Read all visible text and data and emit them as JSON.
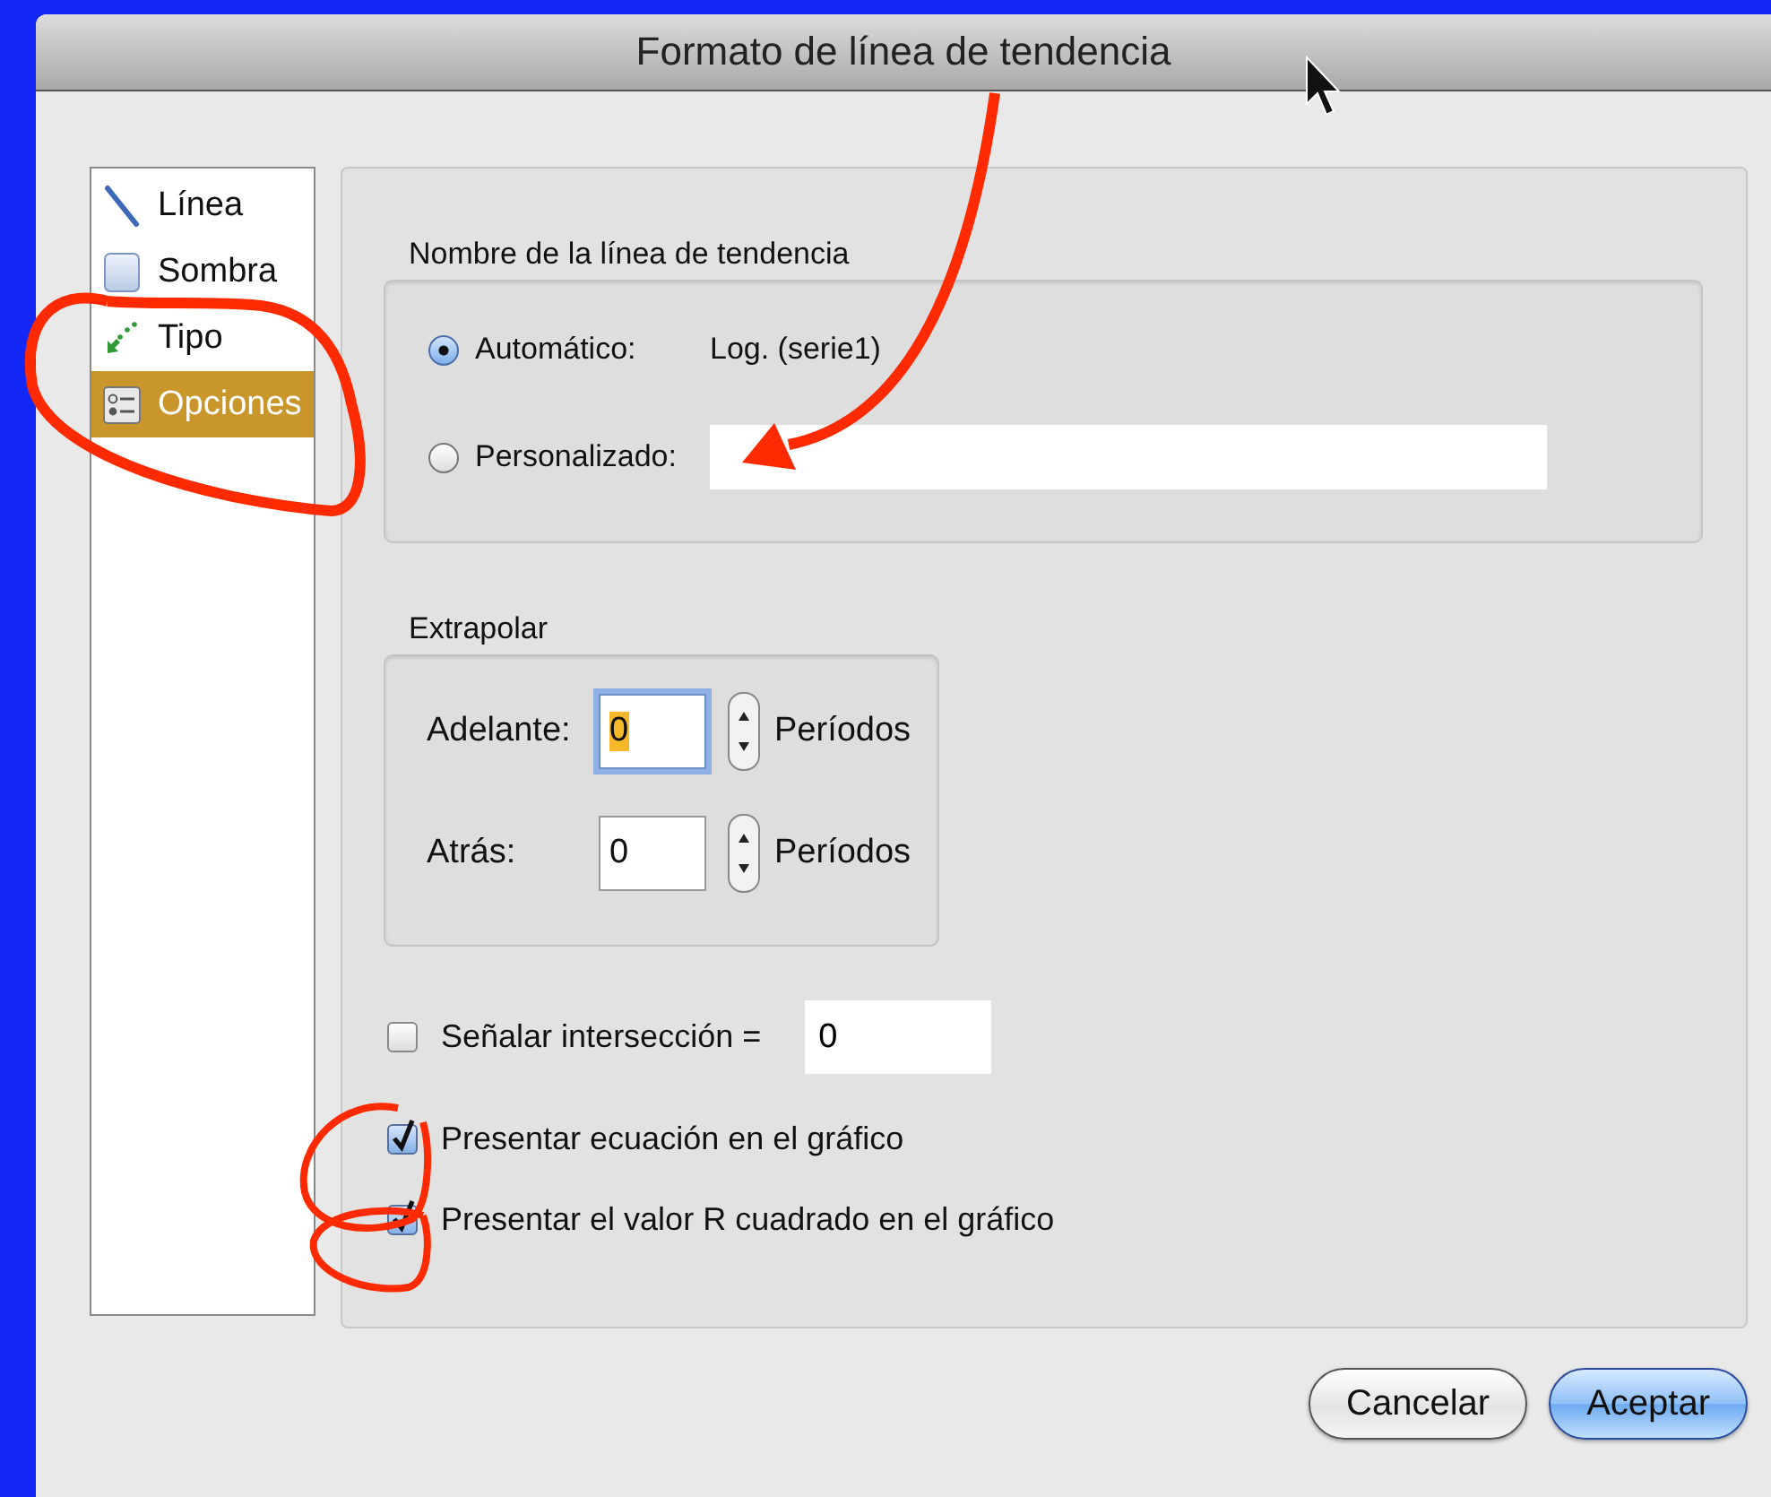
{
  "window": {
    "title": "Formato de línea de tendencia"
  },
  "sidebar": {
    "items": [
      {
        "label": "Línea",
        "kind": "line",
        "selected": false
      },
      {
        "label": "Sombra",
        "kind": "shadow",
        "selected": false
      },
      {
        "label": "Tipo",
        "kind": "type",
        "selected": false
      },
      {
        "label": "Opciones",
        "kind": "options",
        "selected": true
      }
    ]
  },
  "name_group": {
    "title": "Nombre de la línea de tendencia",
    "options": [
      {
        "label": "Automático:",
        "selected": true,
        "kind": "text",
        "value": "Log. (serie1)"
      },
      {
        "label": "Personalizado:",
        "selected": false,
        "kind": "field"
      }
    ]
  },
  "extrapolate": {
    "title": "Extrapolar",
    "rows": [
      {
        "label": "Adelante:",
        "value": "0",
        "unit": "Períodos",
        "focused": true
      },
      {
        "label": "Atrás:",
        "value": "0",
        "unit": "Períodos",
        "focused": false
      }
    ]
  },
  "checks": [
    {
      "label": "Señalar intersección =",
      "checked": false,
      "value": "0"
    },
    {
      "label": "Presentar ecuación en el gráfico",
      "checked": true
    },
    {
      "label": "Presentar el valor R cuadrado en el gráfico",
      "checked": true
    }
  ],
  "buttons": [
    {
      "label": "Cancelar",
      "default": false
    },
    {
      "label": "Aceptar",
      "default": true
    }
  ]
}
